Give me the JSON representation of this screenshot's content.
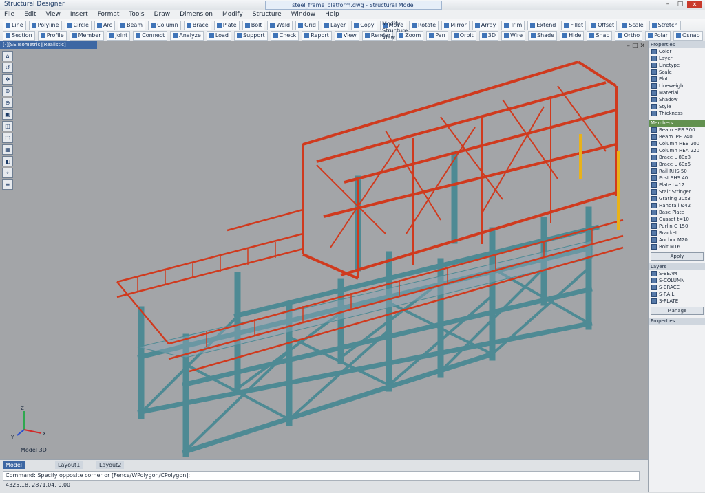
{
  "window": {
    "app_title": "Structural Designer",
    "document_title": "steel_frame_platform.dwg - Structural Model",
    "controls": [
      "–",
      "□",
      "✕"
    ]
  },
  "menu": [
    "File",
    "Edit",
    "View",
    "Insert",
    "Format",
    "Tools",
    "Draw",
    "Dimension",
    "Modify",
    "Structure",
    "Window",
    "Help"
  ],
  "ribbon": {
    "row1": [
      "Line",
      "Polyline",
      "Circle",
      "Arc",
      "Beam",
      "Column",
      "Brace",
      "Plate",
      "Bolt",
      "Weld",
      "Grid",
      "Layer",
      "Copy",
      "Move",
      "Rotate",
      "Mirror",
      "Array",
      "Trim",
      "Extend",
      "Fillet",
      "Offset",
      "Scale",
      "Stretch"
    ],
    "row2": [
      "Section",
      "Profile",
      "Member",
      "Joint",
      "Connect",
      "Analyze",
      "Load",
      "Support",
      "Check",
      "Report",
      "View",
      "Render",
      "Zoom",
      "Pan",
      "Orbit",
      "3D",
      "Wire",
      "Shade",
      "Hide",
      "Snap",
      "Ortho",
      "Polar",
      "Osnap"
    ],
    "group_labels": [
      "Modify",
      "Structure",
      "View"
    ]
  },
  "viewport": {
    "header": "[-][SE Isometric][Realistic]",
    "controls": [
      "–",
      "□",
      "✕"
    ],
    "left_tools": [
      "⌂",
      "↺",
      "✥",
      "⊕",
      "⊖",
      "▣",
      "◫",
      "⬚",
      "▦",
      "◧",
      "⌖",
      "≡"
    ],
    "axis_labels": {
      "x": "X",
      "y": "Y",
      "z": "Z"
    },
    "model_label": "Model 3D"
  },
  "right_panel": {
    "section1_title": "Properties",
    "section1_items": [
      "Color",
      "Layer",
      "Linetype",
      "Scale",
      "Plot",
      "Lineweight",
      "Material",
      "Shadow",
      "Style",
      "Thickness"
    ],
    "section2_title": "Members",
    "section2_items": [
      "Beam HEB 300",
      "Beam IPE 240",
      "Column HEB 200",
      "Column HEA 220",
      "Brace L 80x8",
      "Brace L 60x6",
      "Rail RHS 50",
      "Post SHS 40",
      "Plate t=12",
      "Stair Stringer",
      "Grating 30x3",
      "Handrail Ø42",
      "Base Plate",
      "Gusset t=10",
      "Purlin C 150",
      "Bracket",
      "Anchor M20",
      "Bolt M16"
    ],
    "section2_button": "Apply",
    "section3_title": "Layers",
    "section3_items": [
      "S-BEAM",
      "S-COLUMN",
      "S-BRACE",
      "S-RAIL",
      "S-PLATE"
    ],
    "section3_button": "Manage",
    "footer_label": "Properties"
  },
  "status": {
    "tabs": [
      "Model",
      "Layout1",
      "Layout2"
    ],
    "command_prompt": "Command: Specify opposite corner or [Fence/WPolygon/CPolygon]:",
    "coords": "4325.18, 2871.04, 0.00"
  },
  "colors": {
    "viewport_bg": "#a3a5a8",
    "frame_red": "#d03a1e",
    "structure_teal": "#4e8a94",
    "accent_yellow": "#e9b21a"
  }
}
